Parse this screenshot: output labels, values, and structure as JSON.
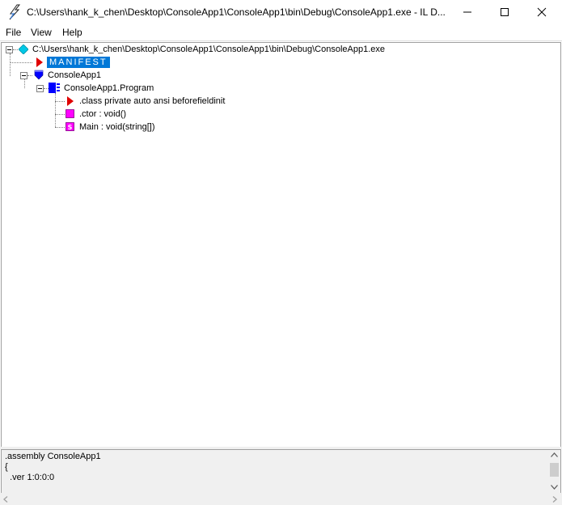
{
  "window": {
    "title": "C:\\Users\\hank_k_chen\\Desktop\\ConsoleApp1\\ConsoleApp1\\bin\\Debug\\ConsoleApp1.exe - IL D..."
  },
  "menu": [
    {
      "label": "File"
    },
    {
      "label": "View"
    },
    {
      "label": "Help"
    }
  ],
  "tree": {
    "root": {
      "label": "C:\\Users\\hank_k_chen\\Desktop\\ConsoleApp1\\ConsoleApp1\\bin\\Debug\\ConsoleApp1.exe",
      "icon": "diamond-icon",
      "color": "#00c8e6"
    },
    "manifest": {
      "label": "MANIFEST",
      "icon": "red-triangle-icon",
      "selected": true
    },
    "namespace": {
      "label": "ConsoleApp1",
      "icon": "namespace-shield-icon",
      "color": "#0000ff"
    },
    "class": {
      "label": "ConsoleApp1.Program",
      "icon": "class-icon",
      "color": "#0000ff"
    },
    "members": [
      {
        "label": ".class private auto ansi beforefieldinit",
        "icon": "red-triangle-icon"
      },
      {
        "label": ".ctor : void()",
        "icon": "method-icon",
        "color": "#ff00ff"
      },
      {
        "label": "Main : void(string[])",
        "icon": "static-method-icon",
        "glyph": "S",
        "color": "#ff00ff"
      }
    ]
  },
  "il": {
    "lines": [
      ".assembly ConsoleApp1",
      "{",
      "  .ver 1:0:0:0"
    ]
  },
  "colors": {
    "selection": "#0078d7",
    "manifest_triangle": "#e00000"
  }
}
